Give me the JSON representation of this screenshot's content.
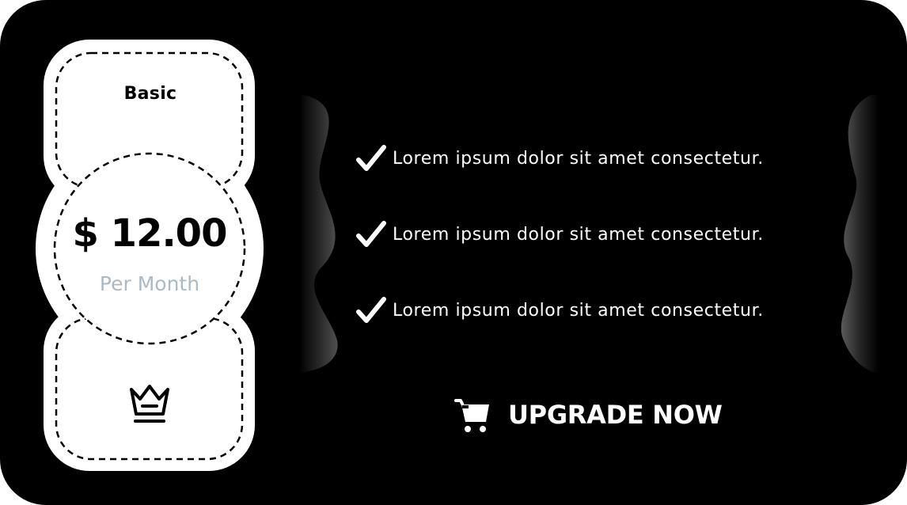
{
  "plan": {
    "name": "Basic",
    "price": "$ 12.00",
    "period": "Per Month",
    "icon": "crown-icon"
  },
  "features": [
    {
      "text": "Lorem ipsum dolor sit amet consectetur.",
      "icon": "check-icon"
    },
    {
      "text": "Lorem ipsum dolor sit amet consectetur.",
      "icon": "check-icon"
    },
    {
      "text": "Lorem ipsum dolor sit amet consectetur.",
      "icon": "check-icon"
    }
  ],
  "cta": {
    "label": "UPGRADE NOW",
    "icon": "cart-icon"
  },
  "colors": {
    "background": "#000000",
    "ticket": "#ffffff",
    "text_light": "#ffffff",
    "period_text": "#a9bac6"
  }
}
